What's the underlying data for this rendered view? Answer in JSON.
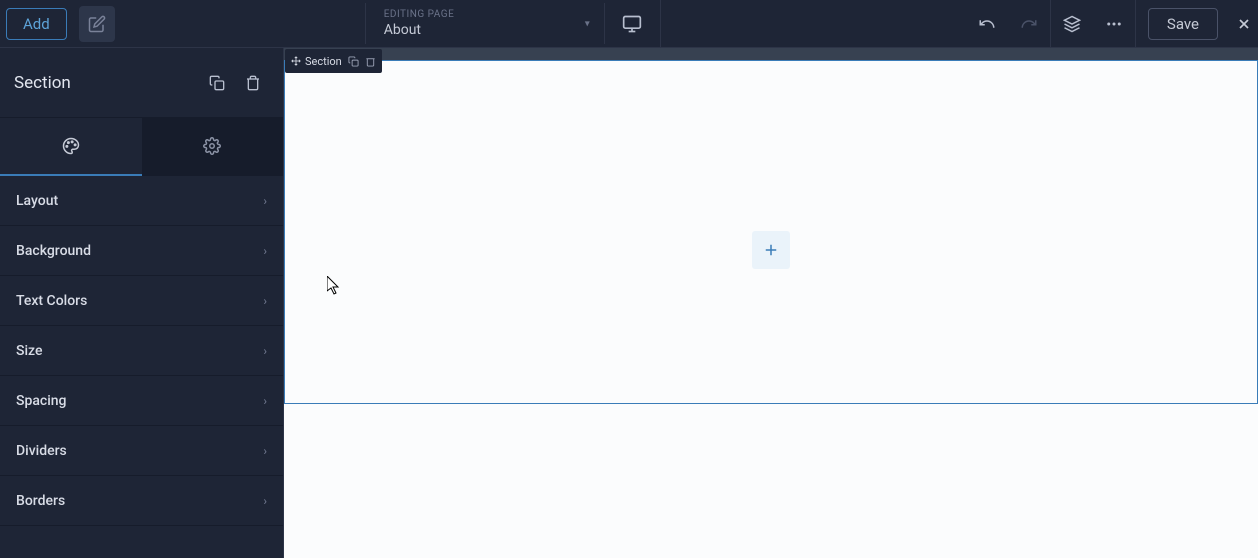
{
  "topbar": {
    "add_label": "Add",
    "page_selector": {
      "label": "EDITING PAGE",
      "value": "About"
    },
    "save_label": "Save"
  },
  "sidebar": {
    "title": "Section",
    "properties": [
      {
        "label": "Layout"
      },
      {
        "label": "Background"
      },
      {
        "label": "Text Colors"
      },
      {
        "label": "Size"
      },
      {
        "label": "Spacing"
      },
      {
        "label": "Dividers"
      },
      {
        "label": "Borders"
      }
    ]
  },
  "canvas": {
    "section_label": "Section"
  }
}
